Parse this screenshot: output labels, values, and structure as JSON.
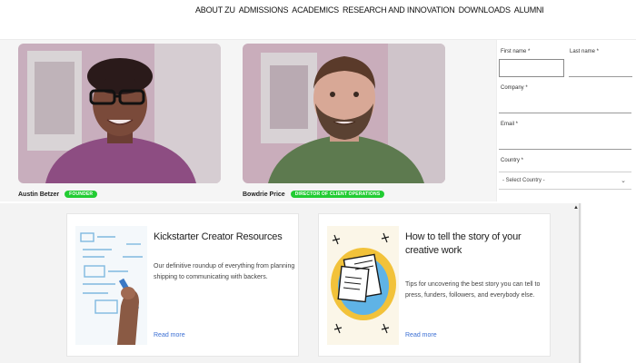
{
  "nav": {
    "items": [
      "ABOUT ZU",
      "ADMISSIONS",
      "ACADEMICS",
      "RESEARCH AND INNOVATION",
      "DOWNLOADS",
      "ALUMNI"
    ]
  },
  "team": [
    {
      "name": "Austin Betzer",
      "role": "FOUNDER"
    },
    {
      "name": "Bowdrie Price",
      "role": "DIRECTOR OF CLIENT OPERATIONS"
    }
  ],
  "form": {
    "first_name_label": "First name *",
    "last_name_label": "Last name *",
    "company_label": "Company *",
    "email_label": "Email *",
    "country_label": "Country *",
    "country_selected": "- Select Country -"
  },
  "articles": [
    {
      "title": "Kickstarter Creator Resources",
      "description": "Our definitive roundup of everything from planning shipping to communicating with backers.",
      "link": "Read more"
    },
    {
      "title": "How to tell the story of your creative work",
      "description": "Tips for uncovering the best story you can tell to press, funders, followers, and everybody else.",
      "link": "Read more"
    }
  ],
  "colors": {
    "role_badge": "#22cc33",
    "link": "#3b6fd4",
    "photo_tint": "#b87fa8"
  }
}
